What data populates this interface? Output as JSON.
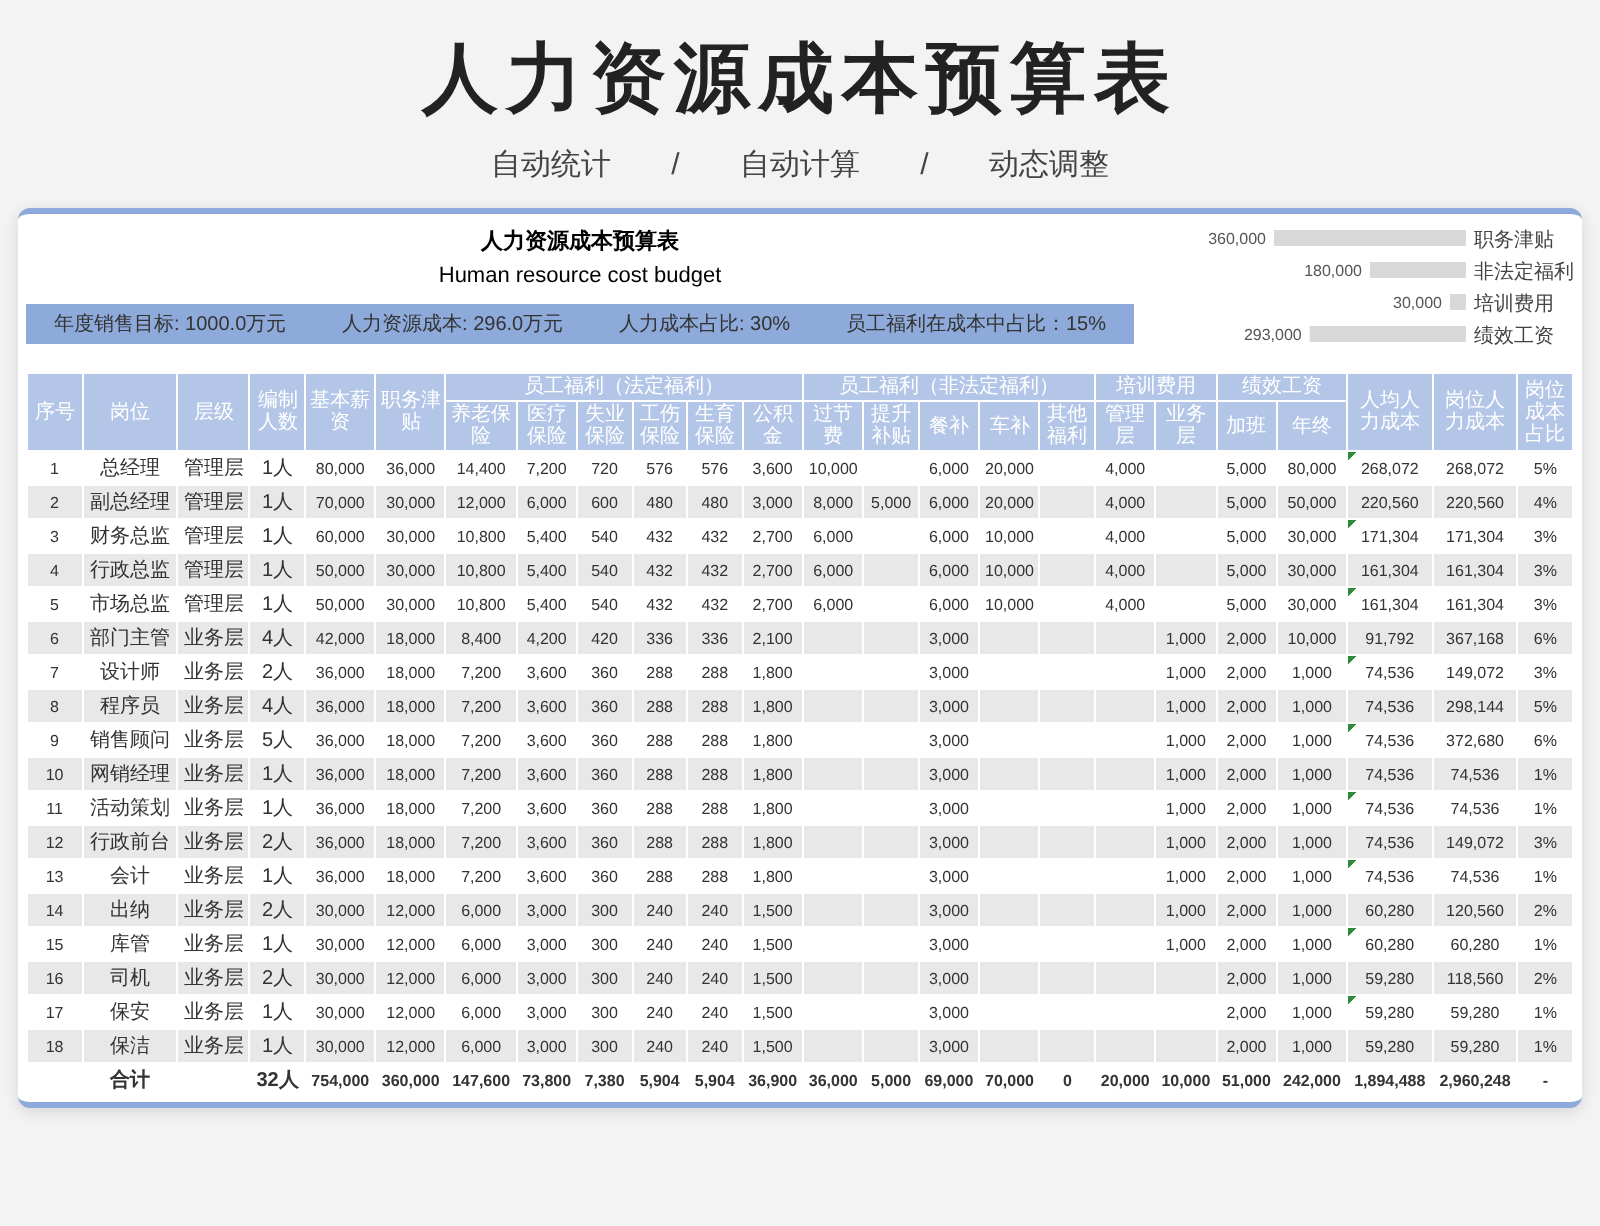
{
  "page_title": "人力资源成本预算表",
  "page_subtitle": "自动统计 / 自动计算 / 动态调整",
  "sheet": {
    "title": "人力资源成本预算表",
    "subtitle": "Human resource cost budget",
    "summary": [
      "年度销售目标: 1000.0万元",
      "人力资源成本: 296.0万元",
      "人力成本占比: 30%",
      "员工福利在成本中占比：15%"
    ],
    "chart_data": {
      "type": "bar",
      "orientation": "horizontal",
      "categories": [
        "职务津贴",
        "非法定福利",
        "培训费用",
        "绩效工资"
      ],
      "values": [
        360000,
        180000,
        30000,
        293000
      ],
      "data_labels": true,
      "value_labels": [
        "360,000",
        "180,000",
        "30,000",
        "293,000"
      ]
    },
    "table": {
      "columns": [
        {
          "label": "序号"
        },
        {
          "label": "岗位"
        },
        {
          "label": "层级"
        },
        {
          "label": "编制人数"
        },
        {
          "label": "基本薪资"
        },
        {
          "label": "职务津贴"
        },
        {
          "label": "员工福利（法定福利）",
          "colspan": 6
        },
        {
          "label": "员工福利（非法定福利）",
          "colspan": 5
        },
        {
          "label": "培训费用",
          "colspan": 2
        },
        {
          "label": "绩效工资",
          "colspan": 2
        },
        {
          "label": "人均人力成本"
        },
        {
          "label": "岗位人力成本"
        },
        {
          "label": "岗位成本占比"
        }
      ],
      "subcolumns": [
        "养老保险",
        "医疗保险",
        "失业保险",
        "工伤保险",
        "生育保险",
        "公积金",
        "过节费",
        "提升补贴",
        "餐补",
        "车补",
        "其他福利",
        "管理层",
        "业务层",
        "加班",
        "年终"
      ],
      "rows": [
        [
          "1",
          "总经理",
          "管理层",
          "1人",
          "80,000",
          "36,000",
          "14,400",
          "7,200",
          "720",
          "576",
          "576",
          "3,600",
          "10,000",
          null,
          "6,000",
          "20,000",
          null,
          "4,000",
          null,
          "5,000",
          "80,000",
          "268,072",
          "268,072",
          "5%"
        ],
        [
          "2",
          "副总经理",
          "管理层",
          "1人",
          "70,000",
          "30,000",
          "12,000",
          "6,000",
          "600",
          "480",
          "480",
          "3,000",
          "8,000",
          "5,000",
          "6,000",
          "20,000",
          null,
          "4,000",
          null,
          "5,000",
          "50,000",
          "220,560",
          "220,560",
          "4%"
        ],
        [
          "3",
          "财务总监",
          "管理层",
          "1人",
          "60,000",
          "30,000",
          "10,800",
          "5,400",
          "540",
          "432",
          "432",
          "2,700",
          "6,000",
          null,
          "6,000",
          "10,000",
          null,
          "4,000",
          null,
          "5,000",
          "30,000",
          "171,304",
          "171,304",
          "3%"
        ],
        [
          "4",
          "行政总监",
          "管理层",
          "1人",
          "50,000",
          "30,000",
          "10,800",
          "5,400",
          "540",
          "432",
          "432",
          "2,700",
          "6,000",
          null,
          "6,000",
          "10,000",
          null,
          "4,000",
          null,
          "5,000",
          "30,000",
          "161,304",
          "161,304",
          "3%"
        ],
        [
          "5",
          "市场总监",
          "管理层",
          "1人",
          "50,000",
          "30,000",
          "10,800",
          "5,400",
          "540",
          "432",
          "432",
          "2,700",
          "6,000",
          null,
          "6,000",
          "10,000",
          null,
          "4,000",
          null,
          "5,000",
          "30,000",
          "161,304",
          "161,304",
          "3%"
        ],
        [
          "6",
          "部门主管",
          "业务层",
          "4人",
          "42,000",
          "18,000",
          "8,400",
          "4,200",
          "420",
          "336",
          "336",
          "2,100",
          null,
          null,
          "3,000",
          null,
          null,
          null,
          "1,000",
          "2,000",
          "10,000",
          "91,792",
          "367,168",
          "6%"
        ],
        [
          "7",
          "设计师",
          "业务层",
          "2人",
          "36,000",
          "18,000",
          "7,200",
          "3,600",
          "360",
          "288",
          "288",
          "1,800",
          null,
          null,
          "3,000",
          null,
          null,
          null,
          "1,000",
          "2,000",
          "1,000",
          "74,536",
          "149,072",
          "3%"
        ],
        [
          "8",
          "程序员",
          "业务层",
          "4人",
          "36,000",
          "18,000",
          "7,200",
          "3,600",
          "360",
          "288",
          "288",
          "1,800",
          null,
          null,
          "3,000",
          null,
          null,
          null,
          "1,000",
          "2,000",
          "1,000",
          "74,536",
          "298,144",
          "5%"
        ],
        [
          "9",
          "销售顾问",
          "业务层",
          "5人",
          "36,000",
          "18,000",
          "7,200",
          "3,600",
          "360",
          "288",
          "288",
          "1,800",
          null,
          null,
          "3,000",
          null,
          null,
          null,
          "1,000",
          "2,000",
          "1,000",
          "74,536",
          "372,680",
          "6%"
        ],
        [
          "10",
          "网销经理",
          "业务层",
          "1人",
          "36,000",
          "18,000",
          "7,200",
          "3,600",
          "360",
          "288",
          "288",
          "1,800",
          null,
          null,
          "3,000",
          null,
          null,
          null,
          "1,000",
          "2,000",
          "1,000",
          "74,536",
          "74,536",
          "1%"
        ],
        [
          "11",
          "活动策划",
          "业务层",
          "1人",
          "36,000",
          "18,000",
          "7,200",
          "3,600",
          "360",
          "288",
          "288",
          "1,800",
          null,
          null,
          "3,000",
          null,
          null,
          null,
          "1,000",
          "2,000",
          "1,000",
          "74,536",
          "74,536",
          "1%"
        ],
        [
          "12",
          "行政前台",
          "业务层",
          "2人",
          "36,000",
          "18,000",
          "7,200",
          "3,600",
          "360",
          "288",
          "288",
          "1,800",
          null,
          null,
          "3,000",
          null,
          null,
          null,
          "1,000",
          "2,000",
          "1,000",
          "74,536",
          "149,072",
          "3%"
        ],
        [
          "13",
          "会计",
          "业务层",
          "1人",
          "36,000",
          "18,000",
          "7,200",
          "3,600",
          "360",
          "288",
          "288",
          "1,800",
          null,
          null,
          "3,000",
          null,
          null,
          null,
          "1,000",
          "2,000",
          "1,000",
          "74,536",
          "74,536",
          "1%"
        ],
        [
          "14",
          "出纳",
          "业务层",
          "2人",
          "30,000",
          "12,000",
          "6,000",
          "3,000",
          "300",
          "240",
          "240",
          "1,500",
          null,
          null,
          "3,000",
          null,
          null,
          null,
          "1,000",
          "2,000",
          "1,000",
          "60,280",
          "120,560",
          "2%"
        ],
        [
          "15",
          "库管",
          "业务层",
          "1人",
          "30,000",
          "12,000",
          "6,000",
          "3,000",
          "300",
          "240",
          "240",
          "1,500",
          null,
          null,
          "3,000",
          null,
          null,
          null,
          "1,000",
          "2,000",
          "1,000",
          "60,280",
          "60,280",
          "1%"
        ],
        [
          "16",
          "司机",
          "业务层",
          "2人",
          "30,000",
          "12,000",
          "6,000",
          "3,000",
          "300",
          "240",
          "240",
          "1,500",
          null,
          null,
          "3,000",
          null,
          null,
          null,
          null,
          "2,000",
          "1,000",
          "59,280",
          "118,560",
          "2%"
        ],
        [
          "17",
          "保安",
          "业务层",
          "1人",
          "30,000",
          "12,000",
          "6,000",
          "3,000",
          "300",
          "240",
          "240",
          "1,500",
          null,
          null,
          "3,000",
          null,
          null,
          null,
          null,
          "2,000",
          "1,000",
          "59,280",
          "59,280",
          "1%"
        ],
        [
          "18",
          "保洁",
          "业务层",
          "1人",
          "30,000",
          "12,000",
          "6,000",
          "3,000",
          "300",
          "240",
          "240",
          "1,500",
          null,
          null,
          "3,000",
          null,
          null,
          null,
          null,
          "2,000",
          "1,000",
          "59,280",
          "59,280",
          "1%"
        ]
      ],
      "total": {
        "label": "合计",
        "headcount": "32人",
        "values": [
          "754,000",
          "360,000",
          "147,600",
          "73,800",
          "7,380",
          "5,904",
          "5,904",
          "36,900",
          "36,000",
          "5,000",
          "69,000",
          "70,000",
          "0",
          "20,000",
          "10,000",
          "51,000",
          "242,000",
          "1,894,488",
          "2,960,248",
          "-"
        ]
      }
    }
  }
}
